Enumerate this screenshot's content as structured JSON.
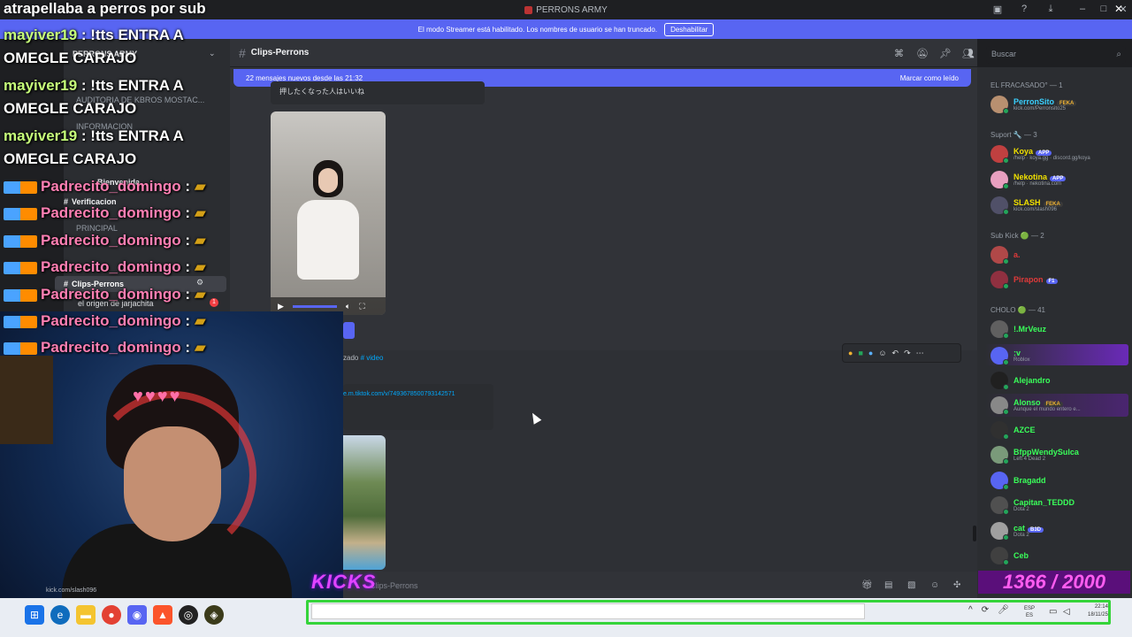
{
  "window": {
    "title": "PERRONS ARMY"
  },
  "banner": {
    "text": "El modo Streamer está habilitado. Los nombres de usuario se han truncado.",
    "button": "Deshabilitar"
  },
  "server": {
    "name": "PERRONS ARMY"
  },
  "channels": [
    {
      "label": "AUDITORIA DE KBROS MOSTAC..."
    },
    {
      "label": "INFORMACION"
    },
    {
      "label": "Bienvenida"
    },
    {
      "label": "Verificacion"
    },
    {
      "label": "PRINCIPAL"
    },
    {
      "label": "Clips-Perrons"
    },
    {
      "label": "el origen de jarjachita"
    }
  ],
  "channel_header": {
    "name": "Clips-Perrons",
    "search_placeholder": "Buscar"
  },
  "new_messages": {
    "text": "22 mensajes nuevos desde las 21:32",
    "action": "Marcar como leído"
  },
  "messages": {
    "quote": "押したくなった人はいいね",
    "forward_label": "zado",
    "forward_channel": "# video",
    "tiktok_link": "e.m.tiktok.com/v/7493678500793142571"
  },
  "composer": {
    "placeholder": "Clips-Perrons"
  },
  "members": {
    "groups": [
      {
        "title": "EL FRACASADO° — 1"
      },
      {
        "title": "Suport 🔧 — 3"
      },
      {
        "title": "Sub Kick 🟢 — 2"
      },
      {
        "title": "CHOLO 🟢 — 41"
      }
    ],
    "list": [
      {
        "name": "PerronSito",
        "badge": "FEKA",
        "sub": "kick.com/Perronsito25",
        "color": "#3ad1ff"
      },
      {
        "name": "Koya",
        "badge": "APP",
        "sub": "/help · koya.gg · discord.gg/koya",
        "color": "#f0e000"
      },
      {
        "name": "Nekotina",
        "badge": "APP",
        "sub": "/help · nekotina.com",
        "color": "#f0e000"
      },
      {
        "name": "SLASH",
        "badge": "FEKA",
        "sub": "kick.com/slash096",
        "color": "#f0e000"
      },
      {
        "name": "a.",
        "badge": "",
        "sub": "",
        "color": "#e03a3a"
      },
      {
        "name": "Pirapon",
        "badge": "F1",
        "sub": "",
        "color": "#e03a3a"
      },
      {
        "name": "!.MrVeuz",
        "badge": "",
        "sub": "",
        "color": "#3aff5a"
      },
      {
        "name": ":v",
        "badge": "",
        "sub": "Roblox",
        "color": "#3aff5a"
      },
      {
        "name": "Alejandro",
        "badge": "",
        "sub": "",
        "color": "#3aff5a"
      },
      {
        "name": "Alonso",
        "badge": "FEKA",
        "sub": "Aunque el mundo entero e...",
        "color": "#3aff5a"
      },
      {
        "name": "AZCE",
        "badge": "",
        "sub": "",
        "color": "#3aff5a"
      },
      {
        "name": "BfppWendySulca",
        "badge": "",
        "sub": "Left 4 Dead 2",
        "color": "#3aff5a"
      },
      {
        "name": "Bragadd",
        "badge": "",
        "sub": "",
        "color": "#3aff5a"
      },
      {
        "name": "Capitan_TEDDD",
        "badge": "",
        "sub": "Dota 2",
        "color": "#3aff5a"
      },
      {
        "name": "cat",
        "badge": "B3D",
        "sub": "Dota 2",
        "color": "#3aff5a"
      },
      {
        "name": "Ceb",
        "badge": "",
        "sub": "",
        "color": "#3aff5a"
      }
    ]
  },
  "stream": {
    "title": "atrapellaba a perros por sub",
    "chat": [
      {
        "user": "mayiver19",
        "msg": ": !tts ENTRA A",
        "cont": "OMEGLE CARAJO"
      },
      {
        "user": "mayiver19",
        "msg": ": !tts ENTRA A",
        "cont": "OMEGLE CARAJO"
      },
      {
        "user": "mayiver19",
        "msg": ": !tts ENTRA A",
        "cont": "OMEGLE CARAJO"
      },
      {
        "user": "Padrecito_domingo",
        "msg": ":"
      },
      {
        "user": "Padrecito_domingo",
        "msg": ":"
      },
      {
        "user": "Padrecito_domingo",
        "msg": ":"
      },
      {
        "user": "Padrecito_domingo",
        "msg": ":"
      },
      {
        "user": "Padrecito_domingo",
        "msg": ":"
      },
      {
        "user": "Padrecito_domingo",
        "msg": ":"
      },
      {
        "user": "Padrecito_domingo",
        "msg": ":"
      }
    ],
    "kicks_label": "KICKS",
    "kicks_count": "1366 / 2000",
    "kick_url": "kick.com/slash096"
  },
  "taskbar": {
    "lang_top": "ESP",
    "lang_bottom": "ES",
    "time": "22:14",
    "date": "18/11/25"
  }
}
